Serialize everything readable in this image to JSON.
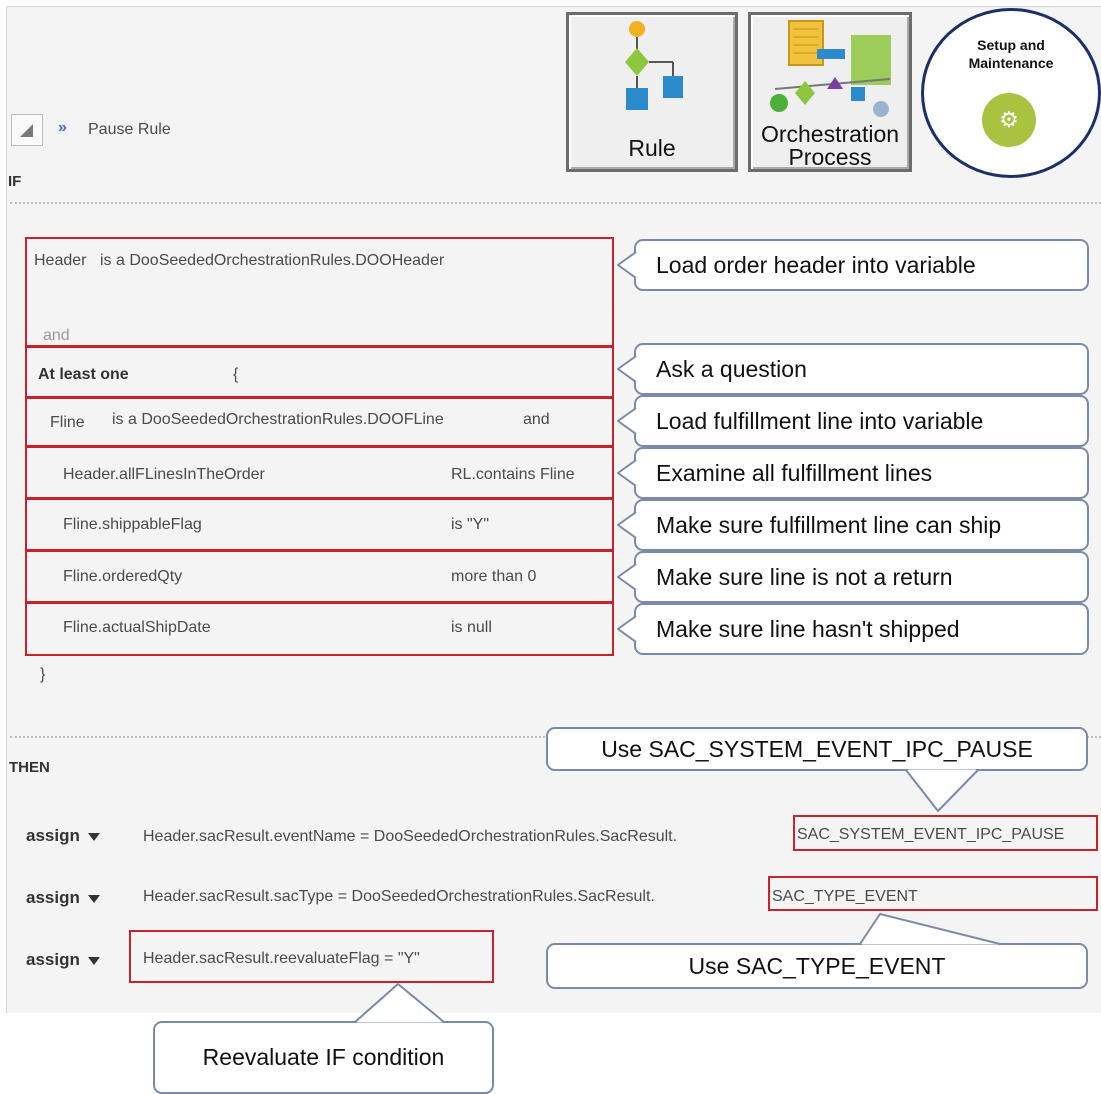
{
  "header": {
    "rule_name": "Pause Rule",
    "buttons": {
      "rule": "Rule",
      "orchestration_line1": "Orchestration",
      "orchestration_line2": "Process",
      "setup_line1": "Setup and",
      "setup_line2": "Maintenance"
    }
  },
  "if_section": {
    "label": "IF",
    "header_var": "Header",
    "header_is": "is a  DooSeededOrchestrationRules.DOOHeader",
    "and": "and",
    "at_least_one": "At least one",
    "open_brace": "{",
    "fline_var": "Fline",
    "fline_is": "is a  DooSeededOrchestrationRules.DOOFLine",
    "fline_and": "and",
    "conditions": [
      {
        "left": "Header.allFLinesInTheOrder",
        "right": "RL.contains  Fline"
      },
      {
        "left": "Fline.shippableFlag",
        "right": "is  \"Y\""
      },
      {
        "left": "Fline.orderedQty",
        "right": "more than  0"
      },
      {
        "left": "Fline.actualShipDate",
        "right": "is  null"
      }
    ],
    "close_brace": "}"
  },
  "then_section": {
    "label": "THEN",
    "assign_label": "assign",
    "rows": [
      {
        "expr": "Header.sacResult.eventName  =  DooSeededOrchestrationRules.SacResult.",
        "value": "SAC_SYSTEM_EVENT_IPC_PAUSE"
      },
      {
        "expr": "Header.sacResult.sacType  =  DooSeededOrchestrationRules.SacResult.",
        "value": "SAC_TYPE_EVENT"
      },
      {
        "expr": "Header.sacResult.reevaluateFlag  =  \"Y\"",
        "value": ""
      }
    ]
  },
  "callouts": {
    "load_header": "Load order header into variable",
    "ask_question": "Ask a question",
    "load_fline": "Load fulfillment  line into variable",
    "examine": "Examine all fulfillment  lines",
    "can_ship": "Make sure fulfillment  line can ship",
    "not_return": "Make sure line is not a return",
    "not_shipped": "Make sure line hasn't shipped",
    "use_pause": "Use SAC_SYSTEM_EVENT_IPC_PAUSE",
    "use_type_event": "Use SAC_TYPE_EVENT",
    "reevaluate": "Reevaluate  IF condition"
  },
  "colors": {
    "highlight_red": "#c8232c",
    "callout_border": "#7a8aa6",
    "panel_bg": "#f4f4f4",
    "setup_green": "#a9c23f"
  }
}
